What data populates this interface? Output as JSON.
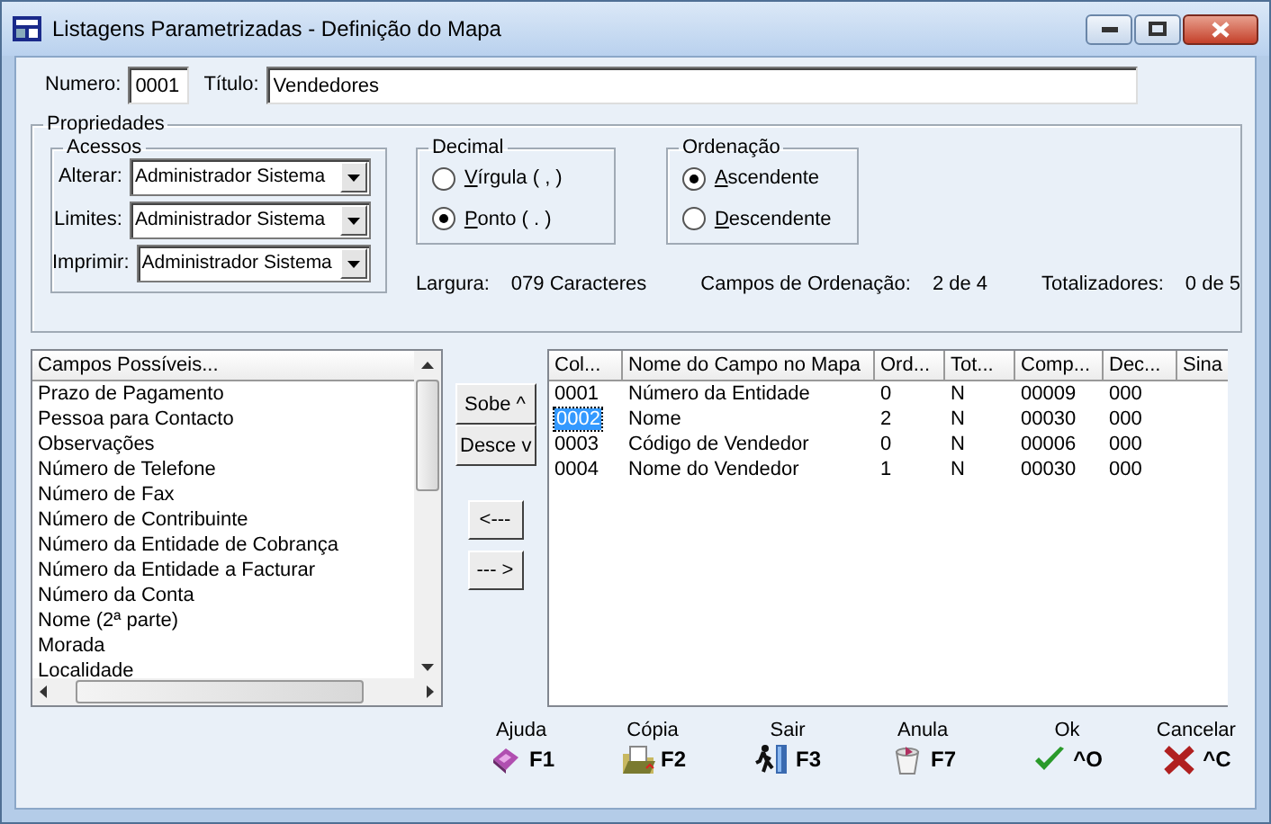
{
  "window": {
    "title": "Listagens Parametrizadas - Definição do Mapa"
  },
  "header": {
    "number_label": "Numero:",
    "number": "0001",
    "title_label": "Título:",
    "title": "Vendedores"
  },
  "properties": {
    "title": "Propriedades",
    "access": {
      "title": "Acessos",
      "fields": [
        {
          "label": "Alterar:",
          "value": "Administrador Sistema"
        },
        {
          "label": "Limites:",
          "value": "Administrador Sistema"
        },
        {
          "label": "Imprimir:",
          "value": "Administrador Sistema"
        }
      ]
    },
    "decimal": {
      "title": "Decimal",
      "options": [
        {
          "label": "Vírgula ( , )",
          "selected": false
        },
        {
          "label": "Ponto ( . )",
          "selected": true
        }
      ]
    },
    "ordering": {
      "title": "Ordenação",
      "options": [
        {
          "label": "Ascendente",
          "selected": true
        },
        {
          "label": "Descendente",
          "selected": false
        }
      ]
    },
    "info": [
      {
        "label": "Largura:",
        "value": "079 Caracteres"
      },
      {
        "label": "Campos de Ordenação:",
        "value": "2 de 4"
      },
      {
        "label": "Totalizadores:",
        "value": "0 de 5"
      }
    ]
  },
  "available_fields": {
    "header": "Campos Possíveis...",
    "items": [
      "Prazo de Pagamento",
      "Pessoa para Contacto",
      "Observações",
      "Número de Telefone",
      "Número de Fax",
      "Número de Contribuinte",
      "Número da Entidade de Cobrança",
      "Número da Entidade a Facturar",
      "Número da Conta",
      "Nome (2ª parte)",
      "Morada",
      "Localidade"
    ]
  },
  "move_buttons": [
    "Sobe ^",
    "Desce v"
  ],
  "transfer_buttons": [
    "<---",
    "--- >"
  ],
  "table": {
    "columns": [
      "Col...",
      "Nome do Campo no Mapa",
      "Ord...",
      "Tot...",
      "Comp...",
      "Dec...",
      "Sina"
    ],
    "rows": [
      {
        "cells": [
          "0001",
          "Número da Entidade",
          "0",
          "N",
          "00009",
          "000"
        ],
        "selected": false
      },
      {
        "cells": [
          "0002",
          "Nome",
          "2",
          "N",
          "00030",
          "000"
        ],
        "selected": true
      },
      {
        "cells": [
          "0003",
          "Código de Vendedor",
          "0",
          "N",
          "00006",
          "000"
        ],
        "selected": false
      },
      {
        "cells": [
          "0004",
          "Nome do Vendedor",
          "1",
          "N",
          "00030",
          "000"
        ],
        "selected": false
      }
    ]
  },
  "toolbar": [
    {
      "kind": "help",
      "label": "Ajuda",
      "key": "F1"
    },
    {
      "kind": "copy",
      "label": "Cópia",
      "key": "F2"
    },
    {
      "kind": "exit",
      "label": "Sair",
      "key": "F3"
    },
    {
      "kind": "undo",
      "label": "Anula",
      "key": "F7"
    },
    {
      "kind": "ok",
      "label": "Ok",
      "key": "^O"
    },
    {
      "kind": "cancel",
      "label": "Cancelar",
      "key": "^C"
    }
  ]
}
